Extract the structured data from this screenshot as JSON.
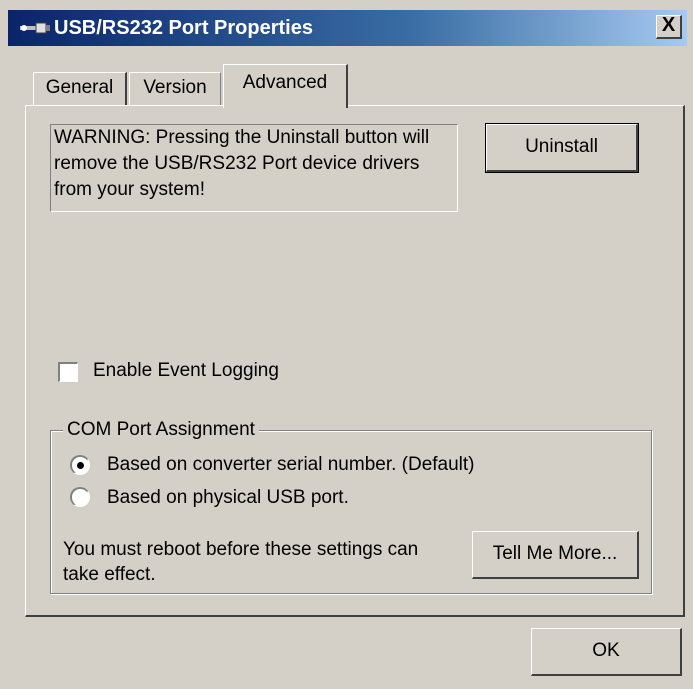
{
  "window": {
    "title": "USB/RS232 Port Properties",
    "close_label": "X"
  },
  "tabs": [
    {
      "label": "General",
      "active": false
    },
    {
      "label": "Version",
      "active": false
    },
    {
      "label": "Advanced",
      "active": true
    }
  ],
  "advanced": {
    "warning_text": "WARNING:  Pressing the Uninstall button will remove the USB/RS232 Port device drivers from your system!",
    "uninstall_label": "Uninstall",
    "event_logging_label": "Enable Event Logging",
    "event_logging_checked": false,
    "com_port": {
      "legend": "COM Port Assignment",
      "options": [
        {
          "label": "Based on converter serial number. (Default)",
          "selected": true
        },
        {
          "label": "Based on physical USB port.",
          "selected": false
        }
      ],
      "note": "You must reboot before these settings can take effect.",
      "tell_more_label": "Tell Me More..."
    }
  },
  "footer": {
    "ok_label": "OK"
  },
  "colors": {
    "face": "#d4d0c8",
    "title_start": "#0a246a",
    "title_end": "#a6caf0"
  }
}
